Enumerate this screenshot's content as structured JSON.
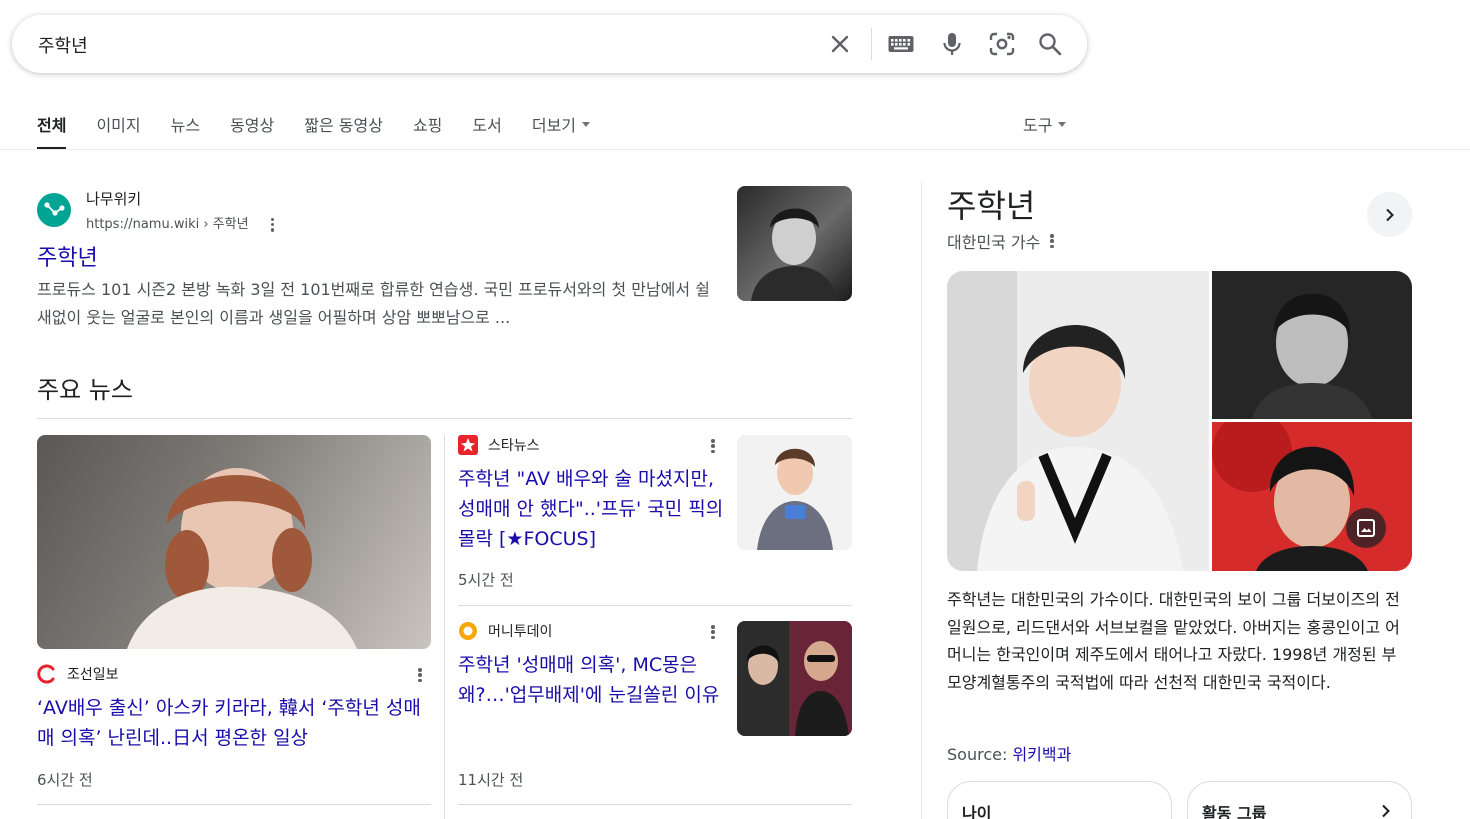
{
  "search": {
    "query": "주학년",
    "icons": [
      "close-icon",
      "keyboard-icon",
      "mic-icon",
      "lens-icon",
      "search-icon"
    ]
  },
  "tabs": [
    {
      "label": "전체",
      "active": true
    },
    {
      "label": "이미지"
    },
    {
      "label": "뉴스"
    },
    {
      "label": "동영상"
    },
    {
      "label": "짧은 동영상"
    },
    {
      "label": "쇼핑"
    },
    {
      "label": "도서"
    },
    {
      "label": "더보기"
    }
  ],
  "tools_label": "도구",
  "result": {
    "site_name": "나무위키",
    "url": "https://namu.wiki › 주학년",
    "title": "주학년",
    "snippet": "프로듀스 101 시즌2 본방 녹화 3일 전 101번째로 합류한 연습생. 국민 프로듀서와의 첫 만남에서 쉴새없이 웃는 얼굴로 본인의 이름과 생일을 어필하며 상암 뽀뽀남으로 ..."
  },
  "news": {
    "heading": "주요 뉴스",
    "items": [
      {
        "source": "조선일보",
        "title": "‘AV배우 출신’ 아스카 키라라, 韓서 ‘주학년 성매매 의혹’ 난린데..日서 평온한 일상",
        "time": "6시간 전"
      },
      {
        "source": "스타뉴스",
        "title": "주학년 \"AV 배우와 술 마셨지만, 성매매 안 했다\"..'프듀' 국민 픽의 몰락 [★FOCUS]",
        "time": "5시간 전"
      },
      {
        "source": "머니투데이",
        "title": "주학년 '성매매 의혹', MC몽은 왜?…'업무배제'에 눈길쏠린 이유",
        "time": "11시간 전"
      }
    ]
  },
  "knowledge_panel": {
    "title": "주학년",
    "subtitle": "대한민국 가수",
    "description": "주학년는 대한민국의 가수이다. 대한민국의 보이 그룹 더보이즈의 전 일원으로, 리드댄서와 서브보컬을 맡았었다. 아버지는 홍콩인이고 어머니는 한국인이며 제주도에서 태어나고 자랐다. 1998년 개정된 부모양계혈통주의 국적법에 따라 선천적 대한민국 국적이다.",
    "source_label": "Source: ",
    "source_link": "위키백과",
    "chips": [
      {
        "label": "나이"
      },
      {
        "label": "활동 그룹"
      }
    ]
  },
  "colors": {
    "link": "#1a0dab",
    "text": "#202124",
    "muted": "#4d5156",
    "namu_logo": "#00a495",
    "chosun_logo": "#e8232c",
    "starnews_logo": "#e8232c",
    "mt_logo": "#f7a70a"
  }
}
